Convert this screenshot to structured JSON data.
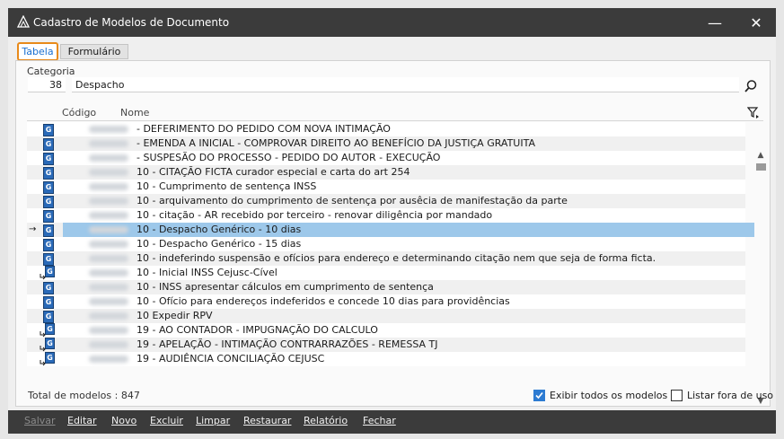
{
  "window": {
    "title": "Cadastro de Modelos de Documento",
    "minimize_glyph": "—",
    "close_glyph": "✕"
  },
  "tabs": [
    {
      "label": "Tabela",
      "active": true
    },
    {
      "label": "Formulário",
      "active": false
    }
  ],
  "category": {
    "label": "Categoria",
    "code": "38",
    "name": "Despacho"
  },
  "grid": {
    "columns": [
      "Código",
      "Nome"
    ],
    "rows": [
      {
        "name": "- DEFERIMENTO DO PEDIDO COM NOVA INTIMAÇÃO",
        "icon": "g",
        "selected": false
      },
      {
        "name": "- EMENDA A INICIAL - COMPROVAR DIREITO AO BENEFÍCIO DA JUSTIÇA GRATUITA",
        "icon": "g",
        "selected": false
      },
      {
        "name": "- SUSPESÃO DO PROCESSO - PEDIDO DO AUTOR - EXECUÇÃO",
        "icon": "g",
        "selected": false
      },
      {
        "name": "10 -  CITAÇÃO FICTA curador especial e carta do art 254",
        "icon": "g",
        "selected": false
      },
      {
        "name": "10 -  Cumprimento de sentença INSS",
        "icon": "g",
        "selected": false
      },
      {
        "name": "10 - arquivamento do cumprimento de sentença por ausêcia de manifestação da parte",
        "icon": "g",
        "selected": false
      },
      {
        "name": "10 - citação - AR recebido por terceiro - renovar diligência por mandado",
        "icon": "g",
        "selected": false
      },
      {
        "name": "10 - Despacho Genérico - 10 dias",
        "icon": "g",
        "selected": true
      },
      {
        "name": "10 - Despacho Genérico - 15 dias",
        "icon": "g",
        "selected": false
      },
      {
        "name": "10 - indeferindo suspensão e ofícios para endereço e determinando citação nem que seja de forma ficta.",
        "icon": "g",
        "selected": false
      },
      {
        "name": "10 - Inicial INSS Cejusc-Cível",
        "icon": "g-sub",
        "selected": false
      },
      {
        "name": "10 - INSS apresentar cálculos em cumprimento de sentença",
        "icon": "g",
        "selected": false
      },
      {
        "name": "10 - Ofício para endereços indeferidos  e concede 10 dias para providências",
        "icon": "g",
        "selected": false
      },
      {
        "name": "10 Expedir RPV",
        "icon": "g",
        "selected": false
      },
      {
        "name": "19 - AO CONTADOR - IMPUGNAÇÃO DO CALCULO",
        "icon": "g-sub",
        "selected": false
      },
      {
        "name": "19 - APELAÇÃO - INTIMAÇÃO CONTRARRAZÕES - REMESSA TJ",
        "icon": "g-sub",
        "selected": false
      },
      {
        "name": "19 - AUDIÊNCIA CONCILIAÇÃO CEJUSC",
        "icon": "g-sub",
        "selected": false
      }
    ],
    "current_row_marker": "→",
    "icon_letter": "G"
  },
  "footer": {
    "total_label": "Total de modelos : 847",
    "show_all_label": "Exibir todos os modelos",
    "show_all_checked": true,
    "list_unused_label": "Listar fora de uso",
    "list_unused_checked": false
  },
  "toolbar": {
    "buttons": [
      {
        "label": "Salvar",
        "enabled": false
      },
      {
        "label": "Editar",
        "enabled": true
      },
      {
        "label": "Novo",
        "enabled": true
      },
      {
        "label": "Excluir",
        "enabled": true
      },
      {
        "label": "Limpar",
        "enabled": true
      },
      {
        "label": "Restaurar",
        "enabled": true
      },
      {
        "label": "Relatório",
        "enabled": true
      },
      {
        "label": "Fechar",
        "enabled": true
      }
    ]
  },
  "colors": {
    "titlebar": "#3b3b3b",
    "selection": "#9dc8ea",
    "active_tab_border": "#e88a1a",
    "checkbox_on": "#2d7bd2"
  }
}
